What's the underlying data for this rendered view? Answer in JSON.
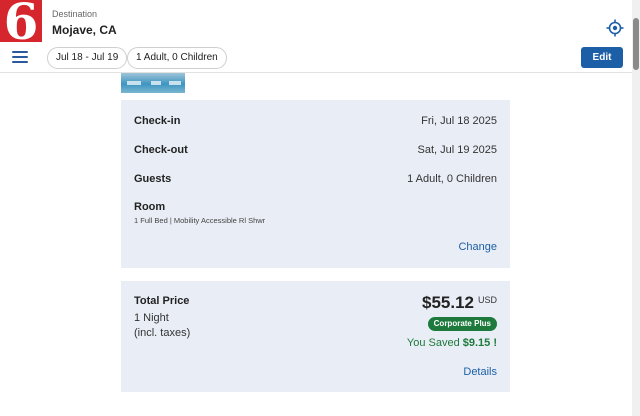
{
  "header": {
    "logo_text": "6",
    "destination_label": "Destination",
    "destination_value": "Mojave, CA",
    "dates_pill": "Jul 18 - Jul 19",
    "guests_pill": "1 Adult, 0 Children",
    "edit_label": "Edit"
  },
  "summary": {
    "checkin_label": "Check-in",
    "checkin_value": "Fri, Jul 18 2025",
    "checkout_label": "Check-out",
    "checkout_value": "Sat, Jul 19 2025",
    "guests_label": "Guests",
    "guests_value": "1 Adult, 0 Children",
    "room_label": "Room",
    "room_desc": "1 Full Bed | Mobility Accessible Rl Shwr",
    "change_link": "Change"
  },
  "price": {
    "total_label": "Total Price",
    "nights": "1 Night",
    "taxes_note": "(incl. taxes)",
    "amount": "$55.12",
    "currency": "USD",
    "rate_badge": "Corporate Plus",
    "saved_prefix": "You Saved ",
    "saved_amount": "$9.15 !",
    "details_link": "Details"
  },
  "colors": {
    "brand_red": "#d5262e",
    "accent_blue": "#1d5fa6",
    "savings_green": "#1e7a3c",
    "card_bg": "#e9eef6"
  }
}
